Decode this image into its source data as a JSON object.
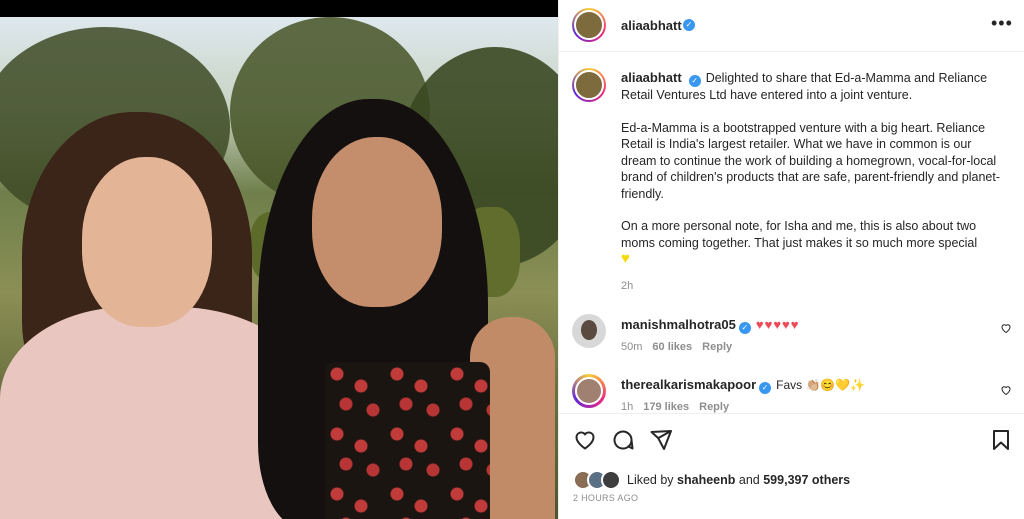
{
  "post": {
    "username": "aliaabhatt",
    "verified_mark": "✓",
    "more_icon": "more-horizontal-icon",
    "image": {
      "description_icon": "post-photo"
    }
  },
  "caption": {
    "username": "aliaabhatt",
    "para1": "Delighted to share that Ed-a-Mamma and Reliance Retail Ventures Ltd have entered into a joint venture.",
    "para2": "Ed-a-Mamma is a bootstrapped venture with a big heart. Reliance Retail is India's largest retailer. What we have in common is our dream to continue the work of building a homegrown, vocal-for-local brand of children's products that are safe, parent-friendly and planet-friendly.",
    "para3": "On a more personal note, for Isha and me, this is also about two moms coming together. That just makes it so much more special",
    "emoji": "♥",
    "time": "2h"
  },
  "comments": [
    {
      "username": "manishmalhotra05",
      "text": "♥♥♥♥♥",
      "time": "50m",
      "likes": "60 likes",
      "reply": "Reply"
    },
    {
      "username": "therealkarismakapoor",
      "text": "Favs 👏🏼😊💛✨",
      "time": "1h",
      "likes": "179 likes",
      "reply": "Reply"
    }
  ],
  "actions": {
    "liked_prefix": "Liked by",
    "liked_user": "shaheenb",
    "liked_and": "and",
    "liked_count": "599,397 others",
    "ago": "2 HOURS AGO"
  },
  "colors": {
    "verified": "#3897f0",
    "heart_red": "#ed4956",
    "heart_yellow": "#f5d90a",
    "muted": "#8e8e8e"
  }
}
